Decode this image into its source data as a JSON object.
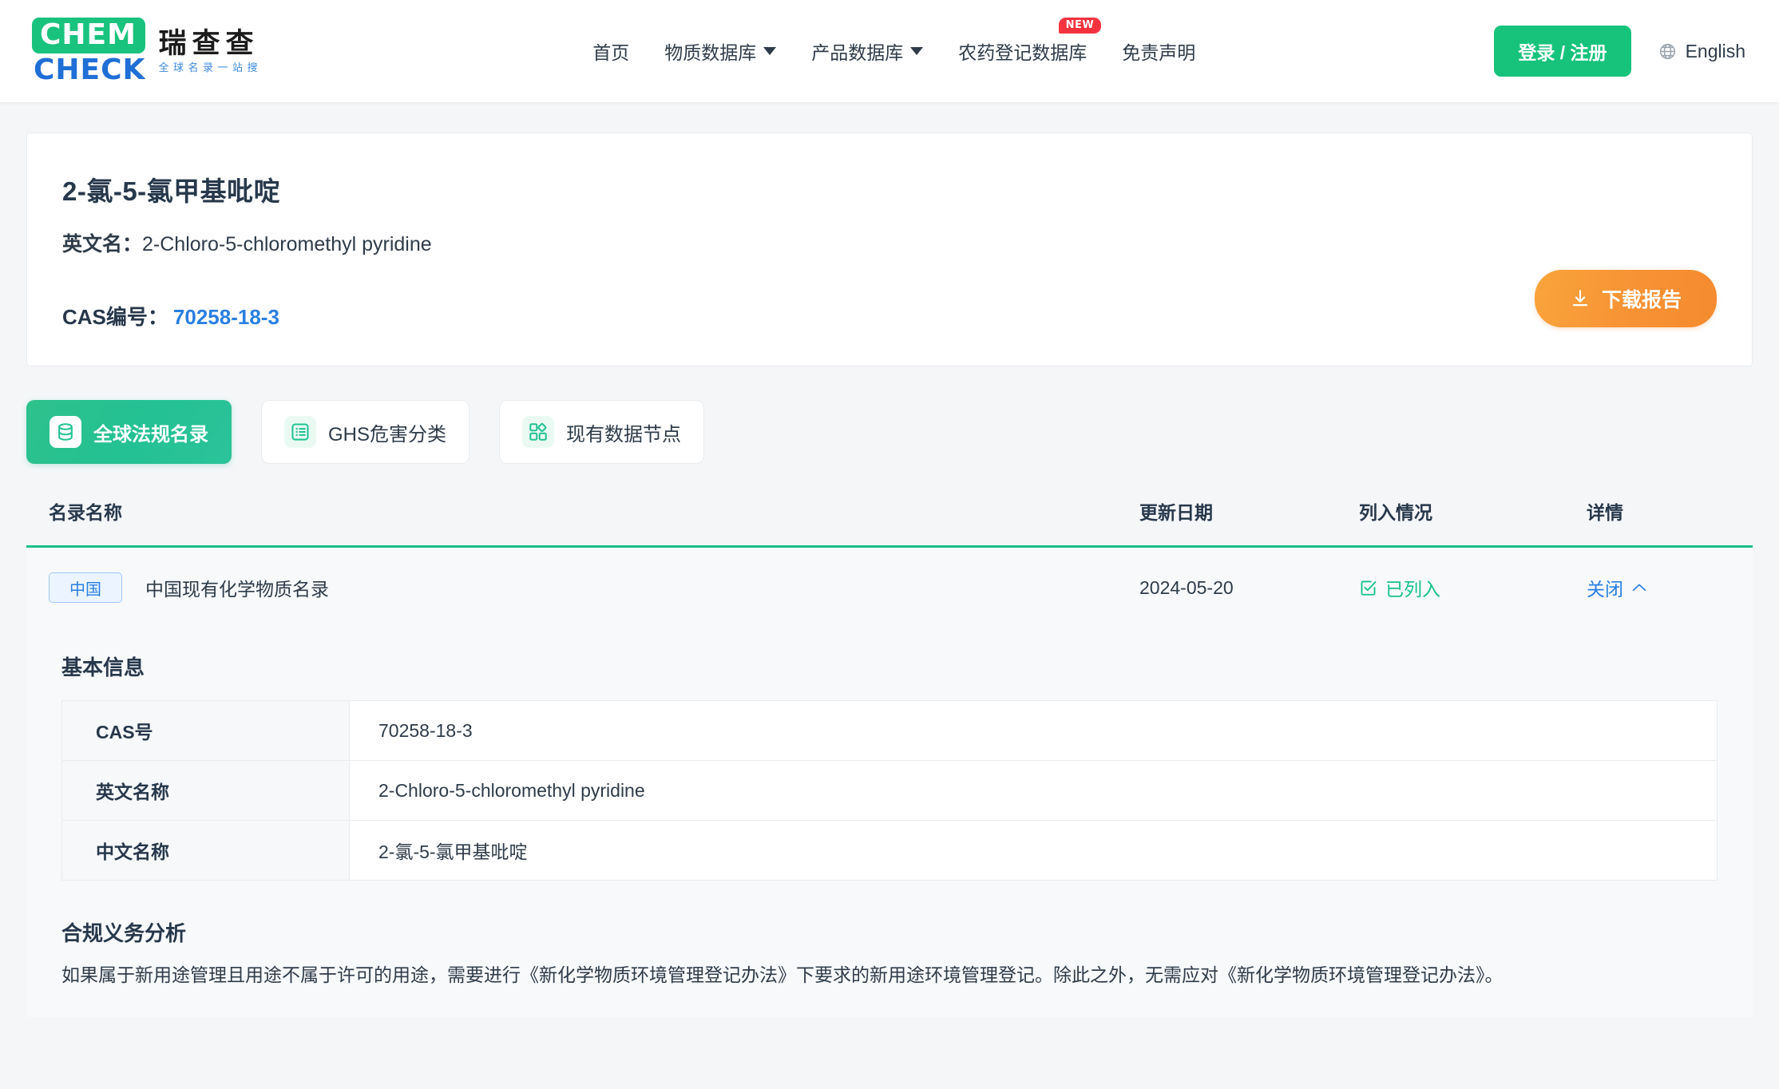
{
  "header": {
    "logo": {
      "chem": "CHEM",
      "check": "CHECK",
      "cn_main": "瑞查查",
      "cn_sub": "全球名录一站搜"
    },
    "nav": [
      {
        "label": "首页",
        "caret": false,
        "badge": ""
      },
      {
        "label": "物质数据库",
        "caret": true,
        "badge": ""
      },
      {
        "label": "产品数据库",
        "caret": true,
        "badge": ""
      },
      {
        "label": "农药登记数据库",
        "caret": false,
        "badge": "NEW"
      },
      {
        "label": "免责声明",
        "caret": false,
        "badge": ""
      }
    ],
    "login_label": "登录 / 注册",
    "language_label": "English"
  },
  "substance": {
    "name_cn": "2-氯-5-氯甲基吡啶",
    "en_label": "英文名：",
    "name_en": "2-Chloro-5-chloromethyl pyridine",
    "cas_label": "CAS编号：",
    "cas_value": "70258-18-3",
    "download_label": "下载报告"
  },
  "tabs": [
    {
      "label": "全球法规名录",
      "icon": "database-icon",
      "active": true
    },
    {
      "label": "GHS危害分类",
      "icon": "list-icon",
      "active": false
    },
    {
      "label": "现有数据节点",
      "icon": "grid-icon",
      "active": false
    }
  ],
  "table": {
    "headers": {
      "name": "名录名称",
      "date": "更新日期",
      "status": "列入情况",
      "detail": "详情"
    },
    "rows": [
      {
        "country": "中国",
        "name": "中国现有化学物质名录",
        "date": "2024-05-20",
        "status": "已列入",
        "detail": "关闭"
      }
    ]
  },
  "panel": {
    "basic_title": "基本信息",
    "basic_rows": [
      {
        "label": "CAS号",
        "value": "70258-18-3"
      },
      {
        "label": "英文名称",
        "value": "2-Chloro-5-chloromethyl pyridine"
      },
      {
        "label": "中文名称",
        "value": "2-氯-5-氯甲基吡啶"
      }
    ],
    "analysis_title": "合规义务分析",
    "analysis_text": "如果属于新用途管理且用途不属于许可的用途，需要进行《新化学物质环境管理登记办法》下要求的新用途环境管理登记。除此之外，无需应对《新化学物质环境管理登记办法》。"
  },
  "colors": {
    "brand_green": "#17c37b",
    "brand_blue": "#1f6fd6",
    "accent_orange": "#f7922f",
    "link_blue": "#2a7fe0",
    "badge_red": "#f5333f"
  }
}
